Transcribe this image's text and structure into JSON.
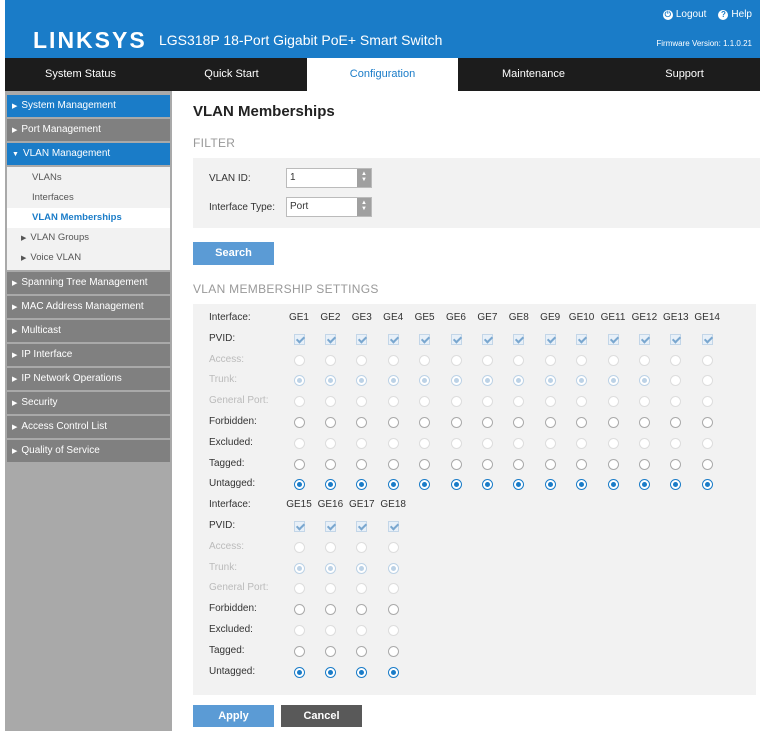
{
  "header": {
    "logo": "LINKSYS",
    "product": "LGS318P 18-Port Gigabit PoE+ Smart Switch",
    "logout": "Logout",
    "help": "Help",
    "firmware": "Firmware Version: 1.1.0.21",
    "color": "#1a7cc8"
  },
  "nav": {
    "tabs": [
      "System Status",
      "Quick Start",
      "Configuration",
      "Maintenance",
      "Support"
    ],
    "active": "Configuration"
  },
  "sidebar": {
    "system_management": "System Management",
    "port_management": "Port Management",
    "vlan_management": "VLAN Management",
    "vlan_subitems": [
      "VLANs",
      "Interfaces",
      "VLAN Memberships",
      "VLAN Groups",
      "Voice VLAN"
    ],
    "after_items": [
      "Spanning Tree Management",
      "MAC Address Management",
      "Multicast",
      "IP Interface",
      "IP Network Operations",
      "Security",
      "Access Control List",
      "Quality of Service"
    ]
  },
  "main": {
    "title": "VLAN Memberships",
    "filter_title": "FILTER",
    "vlan_id_label": "VLAN ID:",
    "vlan_id_value": "1",
    "interface_type_label": "Interface Type:",
    "interface_type_value": "Port",
    "search_label": "Search",
    "settings_title": "VLAN MEMBERSHIP SETTINGS",
    "apply_label": "Apply",
    "cancel_label": "Cancel"
  },
  "membership": {
    "row_labels": [
      "Interface:",
      "PVID:",
      "Access:",
      "Trunk:",
      "General Port:",
      "Forbidden:",
      "Excluded:",
      "Tagged:",
      "Untagged:"
    ],
    "group1": [
      "GE1",
      "GE2",
      "GE3",
      "GE4",
      "GE5",
      "GE6",
      "GE7",
      "GE8",
      "GE9",
      "GE10",
      "GE11",
      "GE12",
      "GE13",
      "GE14"
    ],
    "group2": [
      "GE15",
      "GE16",
      "GE17",
      "GE18"
    ],
    "mode_selected": "Trunk",
    "membership_selected": "Untagged",
    "trunk_unselected_ports": [
      "GE13",
      "GE14"
    ]
  }
}
